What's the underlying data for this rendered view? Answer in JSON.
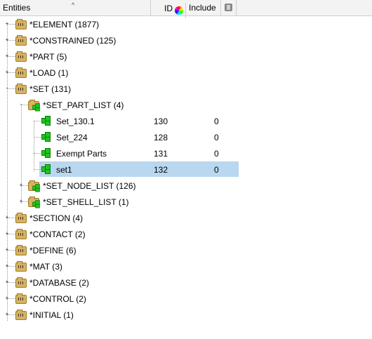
{
  "header": {
    "entities_label": "Entities",
    "id_label": "ID",
    "include_label": "Include",
    "sort_arrow": "^"
  },
  "tree": [
    {
      "label": "*ELEMENT (1877)",
      "kind": "folder",
      "expander": "+"
    },
    {
      "label": "*CONSTRAINED (125)",
      "kind": "folder",
      "expander": "+"
    },
    {
      "label": "*PART (5)",
      "kind": "folder",
      "expander": "+"
    },
    {
      "label": "*LOAD (1)",
      "kind": "folder",
      "expander": "+"
    },
    {
      "label": "*SET (131)",
      "kind": "folder",
      "expander": "-"
    },
    {
      "label": "*SET_PART_LIST (4)",
      "kind": "folder",
      "expander": "-"
    },
    {
      "label": "Set_130.1",
      "id": "130",
      "include": "0",
      "kind": "set"
    },
    {
      "label": "Set_224",
      "id": "128",
      "include": "0",
      "kind": "set"
    },
    {
      "label": "Exempt Parts",
      "id": "131",
      "include": "0",
      "kind": "set"
    },
    {
      "label": "set1",
      "id": "132",
      "include": "0",
      "kind": "set",
      "selected": true
    },
    {
      "label": "*SET_NODE_LIST (126)",
      "kind": "folder",
      "expander": "+"
    },
    {
      "label": "*SET_SHELL_LIST (1)",
      "kind": "folder",
      "expander": "+"
    },
    {
      "label": "*SECTION (4)",
      "kind": "folder",
      "expander": "+"
    },
    {
      "label": "*CONTACT (2)",
      "kind": "folder",
      "expander": "+"
    },
    {
      "label": "*DEFINE (6)",
      "kind": "folder",
      "expander": "+"
    },
    {
      "label": "*MAT (3)",
      "kind": "folder",
      "expander": "+"
    },
    {
      "label": "*DATABASE (2)",
      "kind": "folder",
      "expander": "+"
    },
    {
      "label": "*CONTROL (2)",
      "kind": "folder",
      "expander": "+"
    },
    {
      "label": "*INITIAL (1)",
      "kind": "folder",
      "expander": "+"
    }
  ],
  "colors": {
    "selection": "#b9d7ee",
    "folder": "#d7b260",
    "set_icon": "#1ec51e"
  }
}
